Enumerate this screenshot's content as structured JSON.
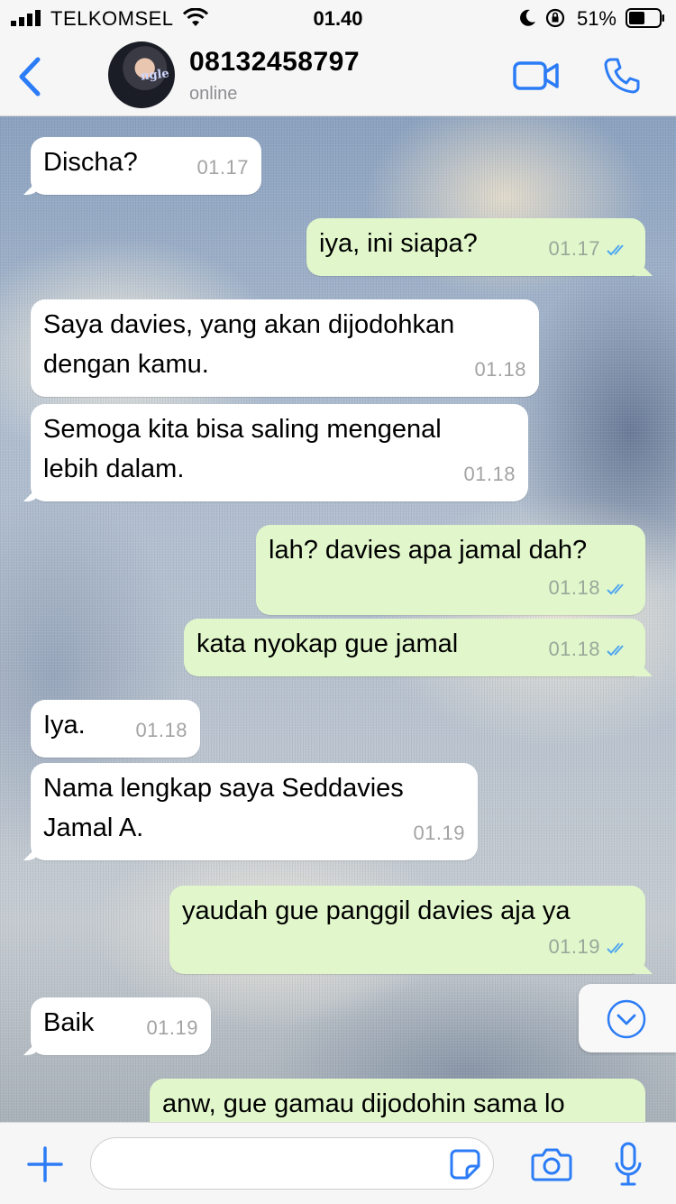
{
  "status_bar": {
    "carrier": "TELKOMSEL",
    "time": "01.40",
    "battery_percent": "51%"
  },
  "header": {
    "contact_name": "08132458797",
    "contact_status": "online",
    "avatar_text": "ngle"
  },
  "messages": [
    {
      "dir": "in",
      "text": "Discha?",
      "time": "01.17"
    },
    {
      "dir": "out",
      "text": "iya, ini siapa?",
      "time": "01.17",
      "read": true
    },
    {
      "dir": "in",
      "text": "Saya davies, yang akan dijodohkan\ndengan kamu.",
      "time": "01.18"
    },
    {
      "dir": "in",
      "text": "Semoga kita bisa saling mengenal\nlebih dalam.",
      "time": "01.18"
    },
    {
      "dir": "out",
      "text": "lah? davies apa jamal dah?",
      "time": "01.18",
      "read": true
    },
    {
      "dir": "out",
      "text": "kata nyokap gue jamal",
      "time": "01.18",
      "read": true
    },
    {
      "dir": "in",
      "text": "Iya.",
      "time": "01.18"
    },
    {
      "dir": "in",
      "text": "Nama lengkap saya Seddavies\nJamal A.",
      "time": "01.19"
    },
    {
      "dir": "out",
      "text": "yaudah gue panggil davies aja ya",
      "time": "01.19",
      "read": true
    },
    {
      "dir": "in",
      "text": "Baik",
      "time": "01.19"
    },
    {
      "dir": "out",
      "text": "anw, gue gamau dijodohin sama lo",
      "time": ""
    }
  ],
  "input": {
    "value": "",
    "placeholder": ""
  },
  "colors": {
    "accent": "#2b7cf6",
    "bubble_in": "#ffffff",
    "bubble_out": "#e1f7cb",
    "read_ticks": "#4fa6f0"
  },
  "icons": [
    "back-chevron-icon",
    "video-call-icon",
    "phone-icon",
    "plus-icon",
    "sticker-icon",
    "camera-icon",
    "microphone-icon",
    "scroll-down-icon",
    "double-check-icon"
  ]
}
